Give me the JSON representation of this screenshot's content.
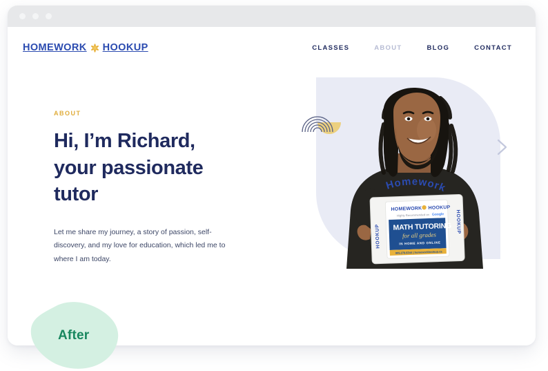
{
  "browser": {
    "traffic_lights": [
      "close",
      "minimize",
      "maximize"
    ]
  },
  "site": {
    "brand": {
      "text_left": "HOMEWORK",
      "text_right": "HOOKUP",
      "mark_icon": "asterisk-star-icon",
      "color": "#2b4bb0",
      "mark_color": "#e8b13a"
    },
    "nav": {
      "items": [
        {
          "label": "CLASSES",
          "active": false
        },
        {
          "label": "ABOUT",
          "active": true
        },
        {
          "label": "BLOG",
          "active": false
        },
        {
          "label": "CONTACT",
          "active": false
        }
      ]
    },
    "hero": {
      "eyebrow": "ABOUT",
      "title": "Hi, I’m Richard, your passionate tutor",
      "paragraph": "Let me share my journey, a story of passion, self-discovery, and my love for education, which led me to where I am today.",
      "eyebrow_color": "#e0ac3a",
      "title_color": "#1f2a5e",
      "paragraph_color": "#3c4666",
      "panel_color": "#e9ebf5",
      "decoration": {
        "arcs_icon": "concentric-arcs-icon",
        "arcs_color": "#5a6285",
        "half_circle_icon": "half-circle-icon",
        "half_circle_color": "#ecd07f"
      },
      "next_arrow_icon": "chevron-right-icon",
      "next_arrow_color": "#c3c8dd",
      "photo": {
        "alt": "Smiling tutor holding a math tutoring sign",
        "shirt_text": "Homework",
        "sign": {
          "brand_left": "HOMEWORK",
          "brand_right": "HOOKUP",
          "tagline": "Highly Recommended on Google",
          "headline": "MATH TUTORING",
          "script": "for all grades",
          "subline": "IN HOME AND ONLINE",
          "side_tab_left": "HOOKUP",
          "side_tab_right": "HOOKUP"
        }
      }
    }
  },
  "after_badge": {
    "label": "After",
    "text_color": "#18875f",
    "blob_color": "#d4f0e2"
  }
}
